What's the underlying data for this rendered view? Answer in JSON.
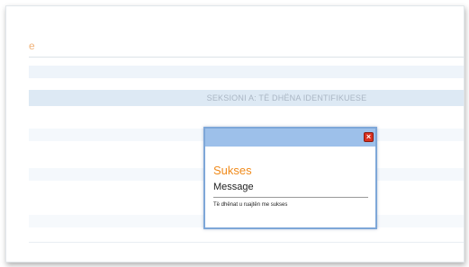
{
  "header": {
    "brand_fragment": "e"
  },
  "section": {
    "title": "SEKSIONI A: TË DHËNA IDENTIFIKUESE"
  },
  "dialog": {
    "close_glyph": "×",
    "heading": "Sukses",
    "subheading": "Message",
    "message": "Të dhënat u ruajtën me sukses"
  },
  "colors": {
    "accent_orange": "#f08a1a",
    "dialog_border": "#7ea7d8",
    "dialog_titlebar": "#9dc0ea",
    "close_red": "#d9301f",
    "band_blue": "#dde9f4"
  },
  "icons": {
    "close": "close-icon"
  }
}
